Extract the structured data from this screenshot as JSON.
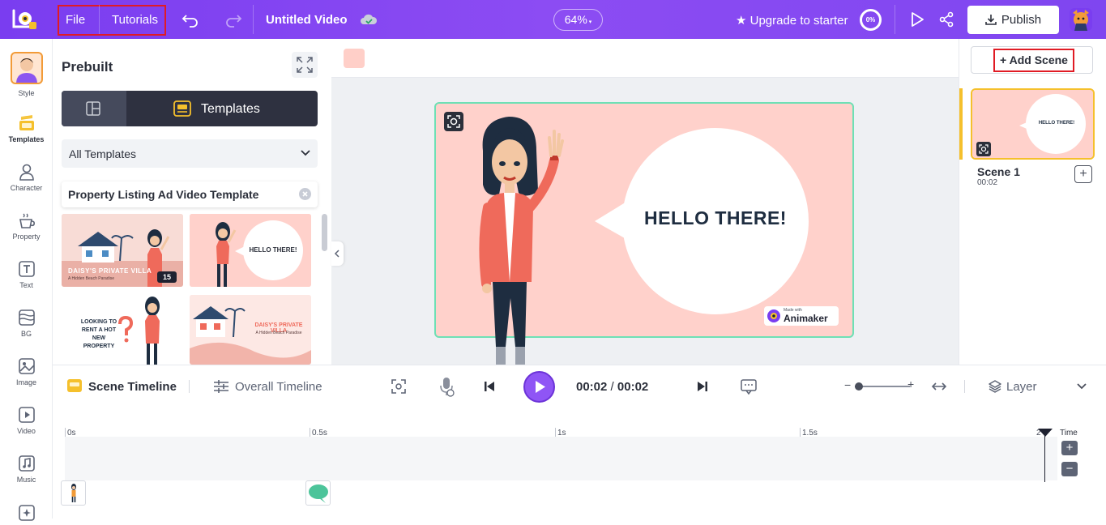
{
  "topbar": {
    "menu": [
      "File",
      "Tutorials"
    ],
    "title": "Untitled Video",
    "zoom": "64%",
    "upgrade": "★ Upgrade to starter",
    "progress": "0%",
    "publish": "Publish"
  },
  "rail": {
    "items": [
      "Style",
      "Templates",
      "Character",
      "Property",
      "Text",
      "BG",
      "Image",
      "Video",
      "Music"
    ]
  },
  "panel": {
    "title": "Prebuilt",
    "tab_label": "Templates",
    "dropdown": "All Templates",
    "chip": "Property Listing Ad Video Template",
    "thumbs": {
      "villa_title": "DAISY'S PRIVATE VILLA",
      "villa_sub": "A Hidden Beach Paradise",
      "badge": "15",
      "hello": "HELLO THERE!",
      "looking": "LOOKING TO RENT A HOT NEW PROPERTY"
    }
  },
  "canvas": {
    "speech": "HELLO THERE!",
    "watermark_small": "Made with",
    "watermark_brand": "Animaker"
  },
  "scenes": {
    "add_label": "+ Add Scene",
    "card_text": "HELLO THERE!",
    "name": "Scene 1",
    "duration": "00:02",
    "plus": "+"
  },
  "timeline": {
    "scene_tab": "Scene Timeline",
    "overall_tab": "Overall Timeline",
    "current": "00:02",
    "sep": "/",
    "total": "00:02",
    "layer": "Layer",
    "ruler": [
      "0s",
      "0.5s",
      "1s",
      "1.5s",
      "2"
    ],
    "time_label": "Time",
    "zoom_in": "+",
    "zoom_out": "−"
  },
  "colors": {
    "brand": "#7a3df0",
    "canvas_bg": "#ffd1cb",
    "canvas_border": "#6ee0b5",
    "scene_accent": "#f5c02c"
  }
}
